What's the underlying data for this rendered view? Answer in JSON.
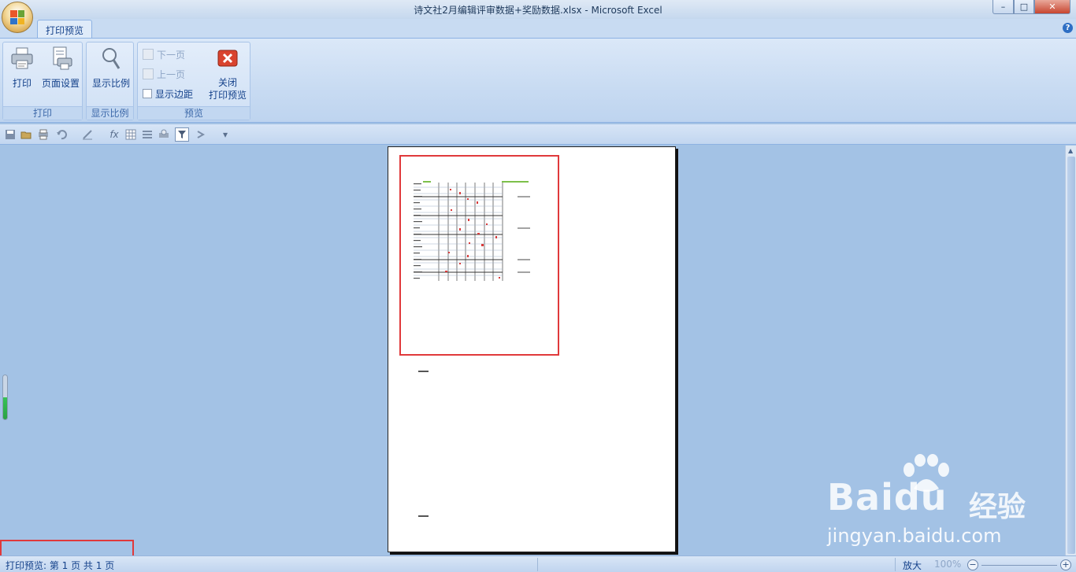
{
  "window": {
    "title": "诗文社2月编辑评审数据+奖励数据.xlsx - Microsoft Excel",
    "minimize_glyph": "–",
    "maximize_glyph": "□",
    "close_glyph": "✕"
  },
  "ribbon": {
    "active_tab": "打印预览",
    "help_glyph": "?",
    "groups": {
      "print": {
        "label": "打印",
        "print_button": "打印",
        "page_setup_button": "页面设置"
      },
      "zoom": {
        "label": "显示比例",
        "zoom_button": "显示比例"
      },
      "preview": {
        "label": "预览",
        "next_page": "下一页",
        "prev_page": "上一页",
        "show_margins": "显示边距",
        "close_line1": "关闭",
        "close_line2": "打印预览"
      }
    }
  },
  "quick_toolbar": {
    "icons": [
      "save-icon",
      "open-icon",
      "print-setup-icon",
      "undo-icon",
      "edit-icon",
      "function-icon",
      "table-icon",
      "rows-icon",
      "printer-icon",
      "filter-icon",
      "sort-icon",
      "customize-icon"
    ],
    "function_glyph": "fx",
    "customize_glyph": "▾"
  },
  "statusbar": {
    "status": "打印预览: 第 1 页  共 1 页",
    "zoom_label": "放大",
    "zoom_percent": "100%",
    "zoom_minus": "−",
    "zoom_plus": "+"
  },
  "watermark": {
    "brand": "Baidu",
    "cn": "经验",
    "url": "jingyan.baidu.com"
  },
  "colors": {
    "highlight": "#e0393b",
    "preview_bg": "#a3c2e5",
    "ribbon_text": "#15428b"
  }
}
